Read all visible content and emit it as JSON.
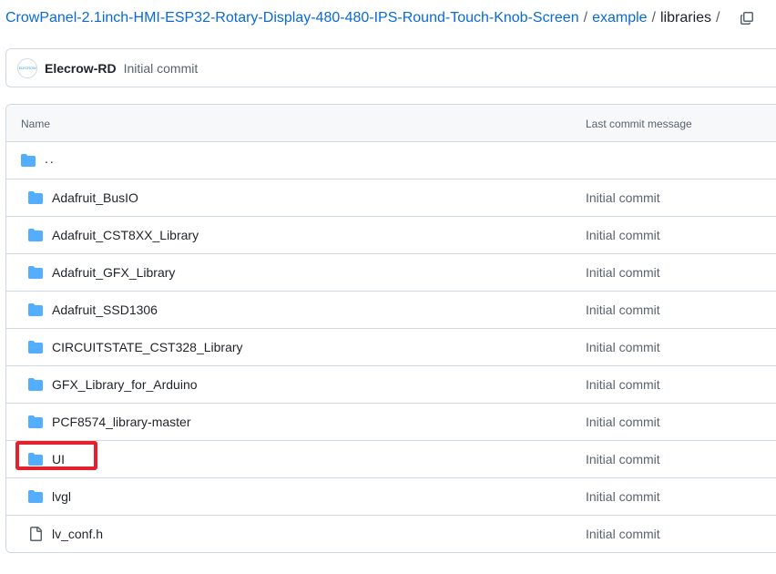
{
  "breadcrumb": {
    "repo": "CrowPanel-2.1inch-HMI-ESP32-Rotary-Display-480-480-IPS-Round-Touch-Knob-Screen",
    "folder": "example",
    "current": "libraries",
    "separator": "/"
  },
  "commit": {
    "author": "Elecrow-RD",
    "message": "Initial commit",
    "avatar_logo": "ELECROW"
  },
  "table": {
    "col_name": "Name",
    "col_commit": "Last commit message",
    "parent": "..",
    "rows": [
      {
        "name": "Adafruit_BusIO",
        "type": "folder",
        "message": "Initial commit"
      },
      {
        "name": "Adafruit_CST8XX_Library",
        "type": "folder",
        "message": "Initial commit"
      },
      {
        "name": "Adafruit_GFX_Library",
        "type": "folder",
        "message": "Initial commit"
      },
      {
        "name": "Adafruit_SSD1306",
        "type": "folder",
        "message": "Initial commit"
      },
      {
        "name": "CIRCUITSTATE_CST328_Library",
        "type": "folder",
        "message": "Initial commit"
      },
      {
        "name": "GFX_Library_for_Arduino",
        "type": "folder",
        "message": "Initial commit"
      },
      {
        "name": "PCF8574_library-master",
        "type": "folder",
        "message": "Initial commit"
      },
      {
        "name": "UI",
        "type": "folder",
        "message": "Initial commit"
      },
      {
        "name": "lvgl",
        "type": "folder",
        "message": "Initial commit"
      },
      {
        "name": "lv_conf.h",
        "type": "file",
        "message": "Initial commit"
      }
    ]
  },
  "colors": {
    "link": "#0969da",
    "folder": "#54aeff",
    "highlight": "#e3202c"
  },
  "icons": {
    "folder": "folder-icon",
    "file": "file-icon",
    "copy": "copy-icon"
  }
}
